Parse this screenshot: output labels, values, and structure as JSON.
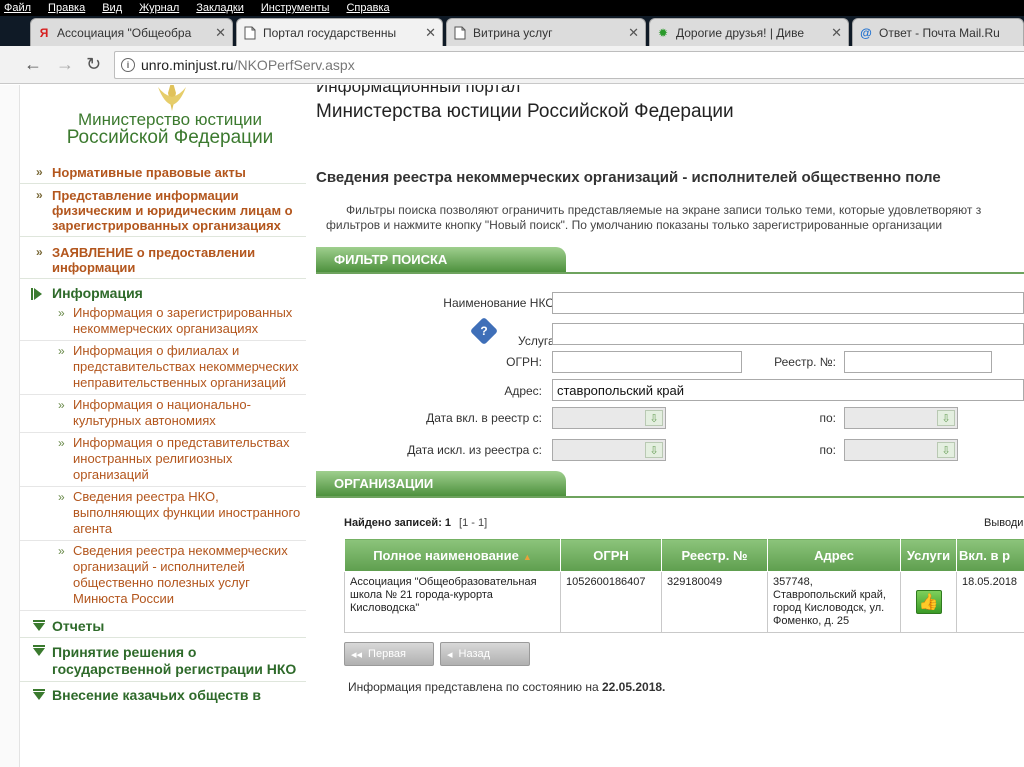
{
  "menu": [
    "Файл",
    "Правка",
    "Вид",
    "Журнал",
    "Закладки",
    "Инструменты",
    "Справка"
  ],
  "tabs": [
    {
      "icon": "Я",
      "label": "Ассоциация \"Общеобра",
      "active": false
    },
    {
      "icon": "doc",
      "label": "Портал государственны",
      "active": true
    },
    {
      "icon": "doc",
      "label": "Витрина услуг",
      "active": false
    },
    {
      "icon": "green",
      "label": "Дорогие друзья! | Диве",
      "active": false
    },
    {
      "icon": "@",
      "label": "Ответ - Почта Mail.Ru",
      "active": false
    }
  ],
  "address": {
    "host": "unro.minjust.ru",
    "path": "/NKOPerfServ.aspx"
  },
  "ministry": {
    "line1": "Министерство юстиции",
    "line2": "Российской Федерации"
  },
  "nav": {
    "items": [
      "Нормативные правовые акты",
      "Представление информации физическим и юридическим лицам о зарегистрированных организациях",
      "ЗАЯВЛЕНИЕ о предоставлении информации"
    ],
    "info_header": "Информация",
    "subitems": [
      "Информация о зарегистрированных некоммерческих организациях",
      "Информация о филиалах и представительствах некоммерческих неправительственных организаций",
      "Информация о национально-культурных автономиях",
      "Информация о представительствах иностранных религиозных организаций",
      "Сведения реестра НКО, выполняющих функции иностранного агента",
      "Сведения реестра некоммерческих организаций - исполнителей общественно полезных услуг Минюста России"
    ],
    "bottom": [
      "Отчеты",
      "Принятие решения о государственной регистрации НКО",
      "Внесение казачьих обществ в"
    ]
  },
  "header": {
    "portal_line1": "Информационный портал",
    "portal_line2": "Министерства юстиции Российской Федерации"
  },
  "registry_title": "Сведения реестра некоммерческих организаций - исполнителей общественно поле",
  "intro": {
    "line1": "Фильтры поиска позволяют ограничить представляемые на экране записи только теми, которые удовлетворяют з",
    "line2": "фильтров и нажмите кнопку \"Новый поиск\". По умолчанию показаны только зарегистрированные организации"
  },
  "filter": {
    "title": "ФИЛЬТР ПОИСКА",
    "name_label": "Наименование НКО:",
    "name_value": "",
    "service_label": "Услуга:",
    "service_value": "",
    "ogrn_label": "ОГРН:",
    "ogrn_value": "",
    "regno_label": "Реестр. №:",
    "regno_value": "",
    "address_label": "Адрес:",
    "address_value": "ставропольский край",
    "date_in_label": "Дата вкл. в реестр с:",
    "date_out_label": "Дата искл. из реестра с:",
    "to_label": "по:"
  },
  "orgs": {
    "title": "ОРГАНИЗАЦИИ",
    "found_label": "Найдено записей: 1",
    "range": "[1 - 1]",
    "output_label": "Выводи",
    "columns": [
      "Полное наименование",
      "ОГРН",
      "Реестр. №",
      "Адрес",
      "Услуги",
      "Вкл. в р"
    ],
    "rows": [
      {
        "name": "Ассоциация \"Общеобразовательная школа № 21 города-курорта Кисловодска\"",
        "ogrn": "1052600186407",
        "regno": "329180049",
        "address": "357748, Ставропольский край, город Кисловодск, ул. Фоменко, д. 25",
        "date": "18.05.2018"
      }
    ]
  },
  "pager": {
    "first": "Первая",
    "back": "Назад"
  },
  "status": {
    "prefix": "Информация представлена по состоянию на",
    "date": "22.05.2018."
  },
  "colors": {
    "brand_green": "#3c7a2f",
    "header_green": "#6ea35e",
    "link_orange": "#b3561d"
  }
}
